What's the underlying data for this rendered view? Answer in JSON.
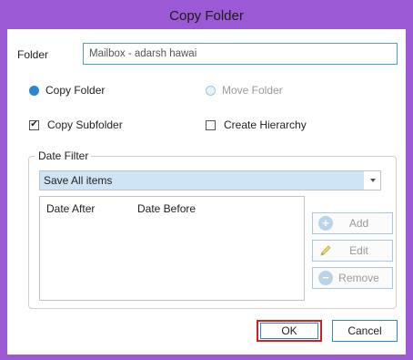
{
  "window": {
    "title": "Copy Folder"
  },
  "folder": {
    "label": "Folder",
    "value": "Mailbox - adarsh hawai"
  },
  "mode": {
    "copy_folder": {
      "label": "Copy Folder",
      "selected": true,
      "enabled": true
    },
    "move_folder": {
      "label": "Move Folder",
      "selected": false,
      "enabled": false
    }
  },
  "options": {
    "copy_subfolder": {
      "label": "Copy Subfolder",
      "checked": true,
      "mark": "✔"
    },
    "create_hierarchy": {
      "label": "Create Hierarchy",
      "checked": false
    }
  },
  "date_filter": {
    "title": "Date Filter",
    "selected_option": "Save All items",
    "columns": [
      "Date After",
      "Date Before"
    ],
    "add_label": "Add",
    "edit_label": "Edit",
    "remove_label": "Remove"
  },
  "footer": {
    "ok_label": "OK",
    "cancel_label": "Cancel"
  },
  "colors": {
    "accent": "#2b86d6",
    "window_frame": "#9b59d6",
    "highlight": "#d62020"
  }
}
